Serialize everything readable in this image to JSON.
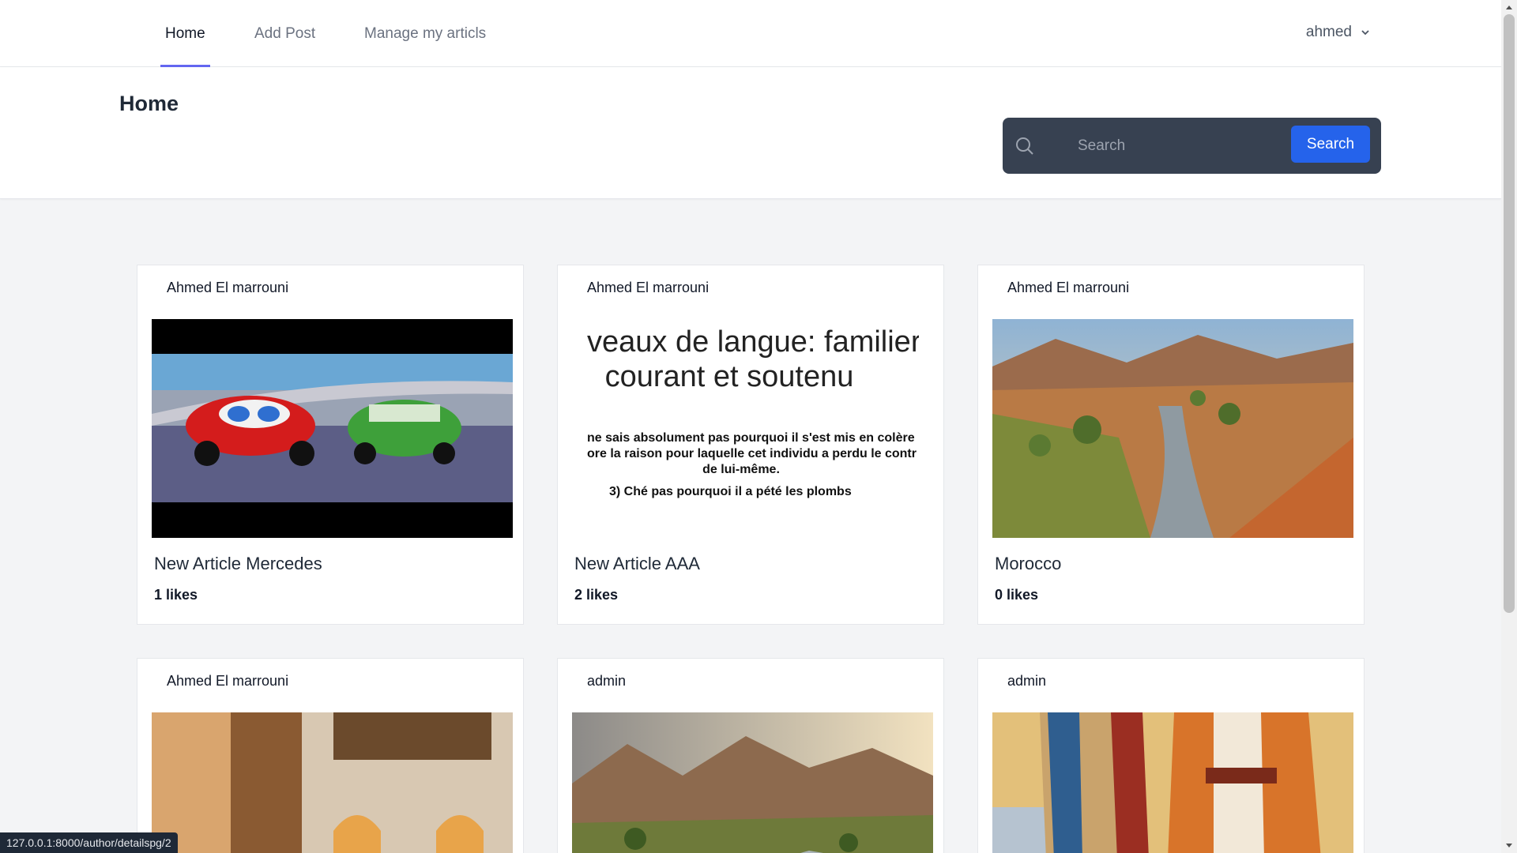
{
  "nav": {
    "links": [
      {
        "label": "Home",
        "active": true
      },
      {
        "label": "Add Post",
        "active": false
      },
      {
        "label": "Manage my articls",
        "active": false
      }
    ],
    "user": "ahmed"
  },
  "header": {
    "title": "Home",
    "search_placeholder": "Search",
    "search_button": "Search"
  },
  "cards": [
    {
      "author": "Ahmed El marrouni",
      "title": "New Article Mercedes",
      "likes": "1 likes",
      "image": "cars-animation-still"
    },
    {
      "author": "Ahmed El marrouni",
      "title": "New Article AAA",
      "likes": "2 likes",
      "image": "french-language-slide",
      "image_text": {
        "line1": "veaux de langue: familier,",
        "line2": "courant et soutenu",
        "line3": "ne sais absolument pas pourquoi il s'est mis en colère !",
        "line4": "ore la raison pour laquelle cet individu a perdu le contr",
        "line5": "de lui-même.",
        "line6": "3) Ché pas pourquoi il a pété les plombs"
      }
    },
    {
      "author": "Ahmed El marrouni",
      "title": "Morocco",
      "likes": "0 likes",
      "image": "moroccan-valley"
    },
    {
      "author": "Ahmed El marrouni",
      "title": "",
      "likes": "",
      "image": "moroccan-riad"
    },
    {
      "author": "admin",
      "title": "",
      "likes": "",
      "image": "atlas-mountains"
    },
    {
      "author": "admin",
      "title": "",
      "likes": "",
      "image": "moroccan-clothing"
    }
  ],
  "status_url": "127.0.0.1:8000/author/detailspg/2",
  "colors": {
    "accent": "#6366f1",
    "search_bg": "#374151",
    "button": "#2563eb"
  }
}
